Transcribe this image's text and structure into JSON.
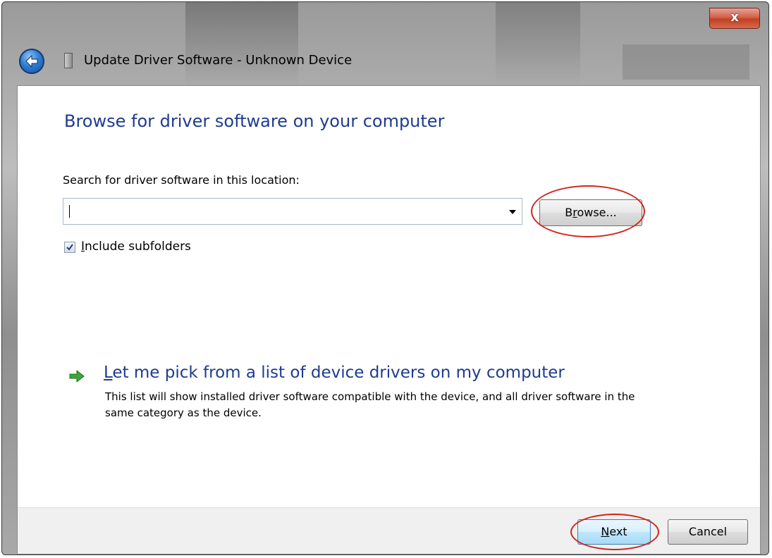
{
  "window": {
    "title": "Update Driver Software - Unknown Device",
    "close_glyph": "x"
  },
  "main": {
    "heading": "Browse for driver software on your computer",
    "location_label": "Search for driver software in this location:",
    "path_value": "",
    "browse": {
      "before": "B",
      "accel": "r",
      "after": "owse..."
    },
    "include_subfolders": {
      "accel": "I",
      "rest": "nclude subfolders",
      "checked": true
    },
    "pick_list": {
      "accel": "L",
      "title_rest": "et me pick from a list of device drivers on my computer",
      "description": "This list will show installed driver software compatible with the device, and all driver software in the same category as the device."
    }
  },
  "footer": {
    "next": {
      "accel": "N",
      "rest": "ext"
    },
    "cancel_label": "Cancel"
  },
  "colors": {
    "heading": "#1e3b8f",
    "highlight": "#d0261c",
    "arrow": "#3aa63a"
  },
  "icons": [
    "back-arrow-icon",
    "device-icon",
    "close-icon",
    "checkmark-icon",
    "green-arrow-icon",
    "chevron-down-icon"
  ]
}
